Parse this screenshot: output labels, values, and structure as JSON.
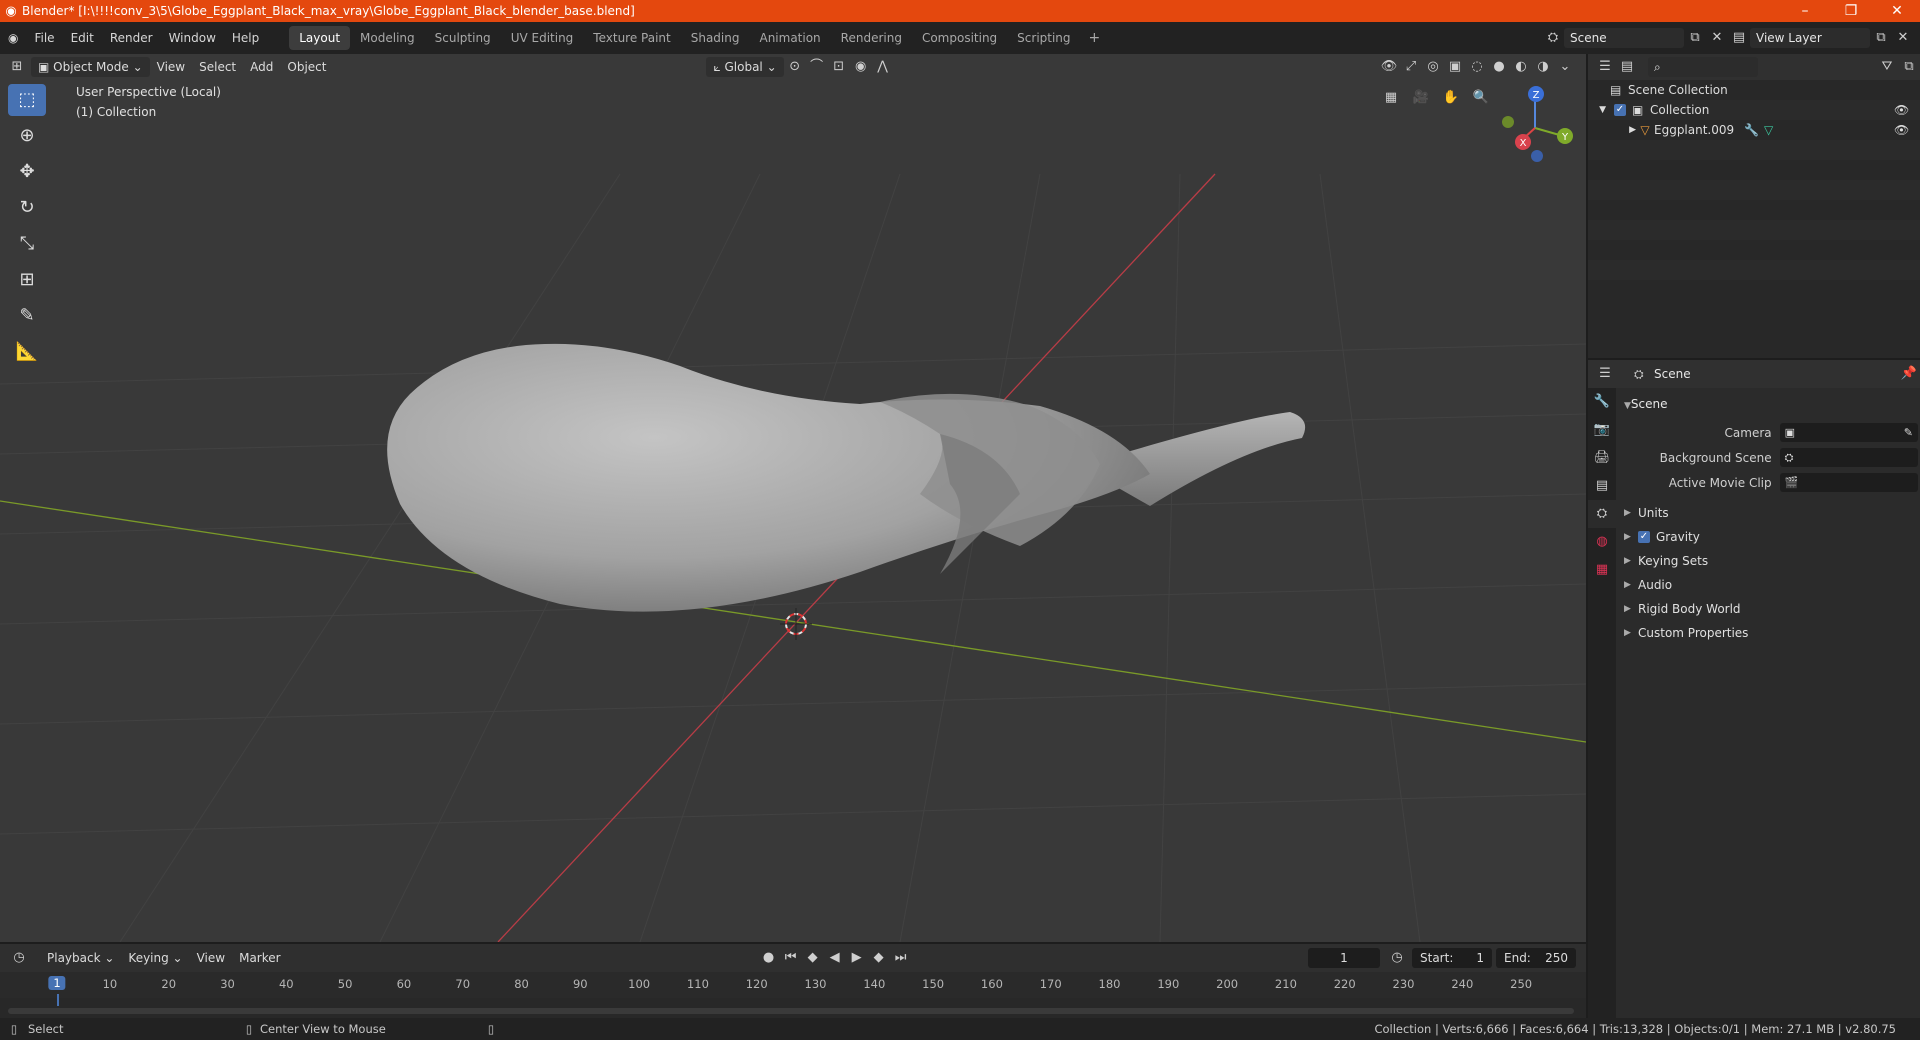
{
  "window": {
    "title": "Blender* [I:\\!!!!conv_3\\5\\Globe_Eggplant_Black_max_vray\\Globe_Eggplant_Black_blender_base.blend]",
    "minimize": "–",
    "maximize": "❐",
    "close": "✕"
  },
  "menu": [
    "File",
    "Edit",
    "Render",
    "Window",
    "Help"
  ],
  "workspaces": [
    "Layout",
    "Modeling",
    "Sculpting",
    "UV Editing",
    "Texture Paint",
    "Shading",
    "Animation",
    "Rendering",
    "Compositing",
    "Scripting"
  ],
  "workspace_add": "+",
  "scene_name": "Scene",
  "view_layer": "View Layer",
  "viewport": {
    "mode": "Object Mode",
    "menus": [
      "View",
      "Select",
      "Add",
      "Object"
    ],
    "transform_orientation": "Global",
    "info_line1": "User Perspective (Local)",
    "info_line2": "(1) Collection",
    "gizmo": {
      "x": "X",
      "y": "Y",
      "z": "Z"
    }
  },
  "outliner": {
    "rows": [
      {
        "label": "Scene Collection"
      },
      {
        "label": "Collection"
      },
      {
        "label": "Eggplant.009"
      }
    ]
  },
  "properties": {
    "header_title": "Scene",
    "panel_title": "Scene",
    "fields": [
      {
        "label": "Camera"
      },
      {
        "label": "Background Scene"
      },
      {
        "label": "Active Movie Clip"
      }
    ],
    "subpanels": [
      "Units",
      "Gravity",
      "Keying Sets",
      "Audio",
      "Rigid Body World",
      "Custom Properties"
    ]
  },
  "timeline": {
    "menus": [
      "Playback",
      "Keying",
      "View",
      "Marker"
    ],
    "current_frame": "1",
    "start_label": "Start:",
    "start": "1",
    "end_label": "End:",
    "end": "250",
    "ticks": [
      "10",
      "20",
      "30",
      "40",
      "50",
      "60",
      "70",
      "80",
      "90",
      "100",
      "110",
      "120",
      "130",
      "140",
      "150",
      "160",
      "170",
      "180",
      "190",
      "200",
      "210",
      "220",
      "230",
      "240",
      "250"
    ],
    "playhead": "1"
  },
  "status": {
    "left": "Select",
    "middle": "Center View to Mouse",
    "right": "Collection | Verts:6,666 | Faces:6,664 | Tris:13,328 | Objects:0/1 | Mem: 27.1 MB | v2.80.75"
  },
  "colors": {
    "accent": "#4772b3",
    "titlebar": "#e4480e",
    "viewport_bg": "#393939",
    "x_axis": "#c0404a",
    "y_axis": "#7ea02a",
    "mesh": "#a8a8a8"
  }
}
